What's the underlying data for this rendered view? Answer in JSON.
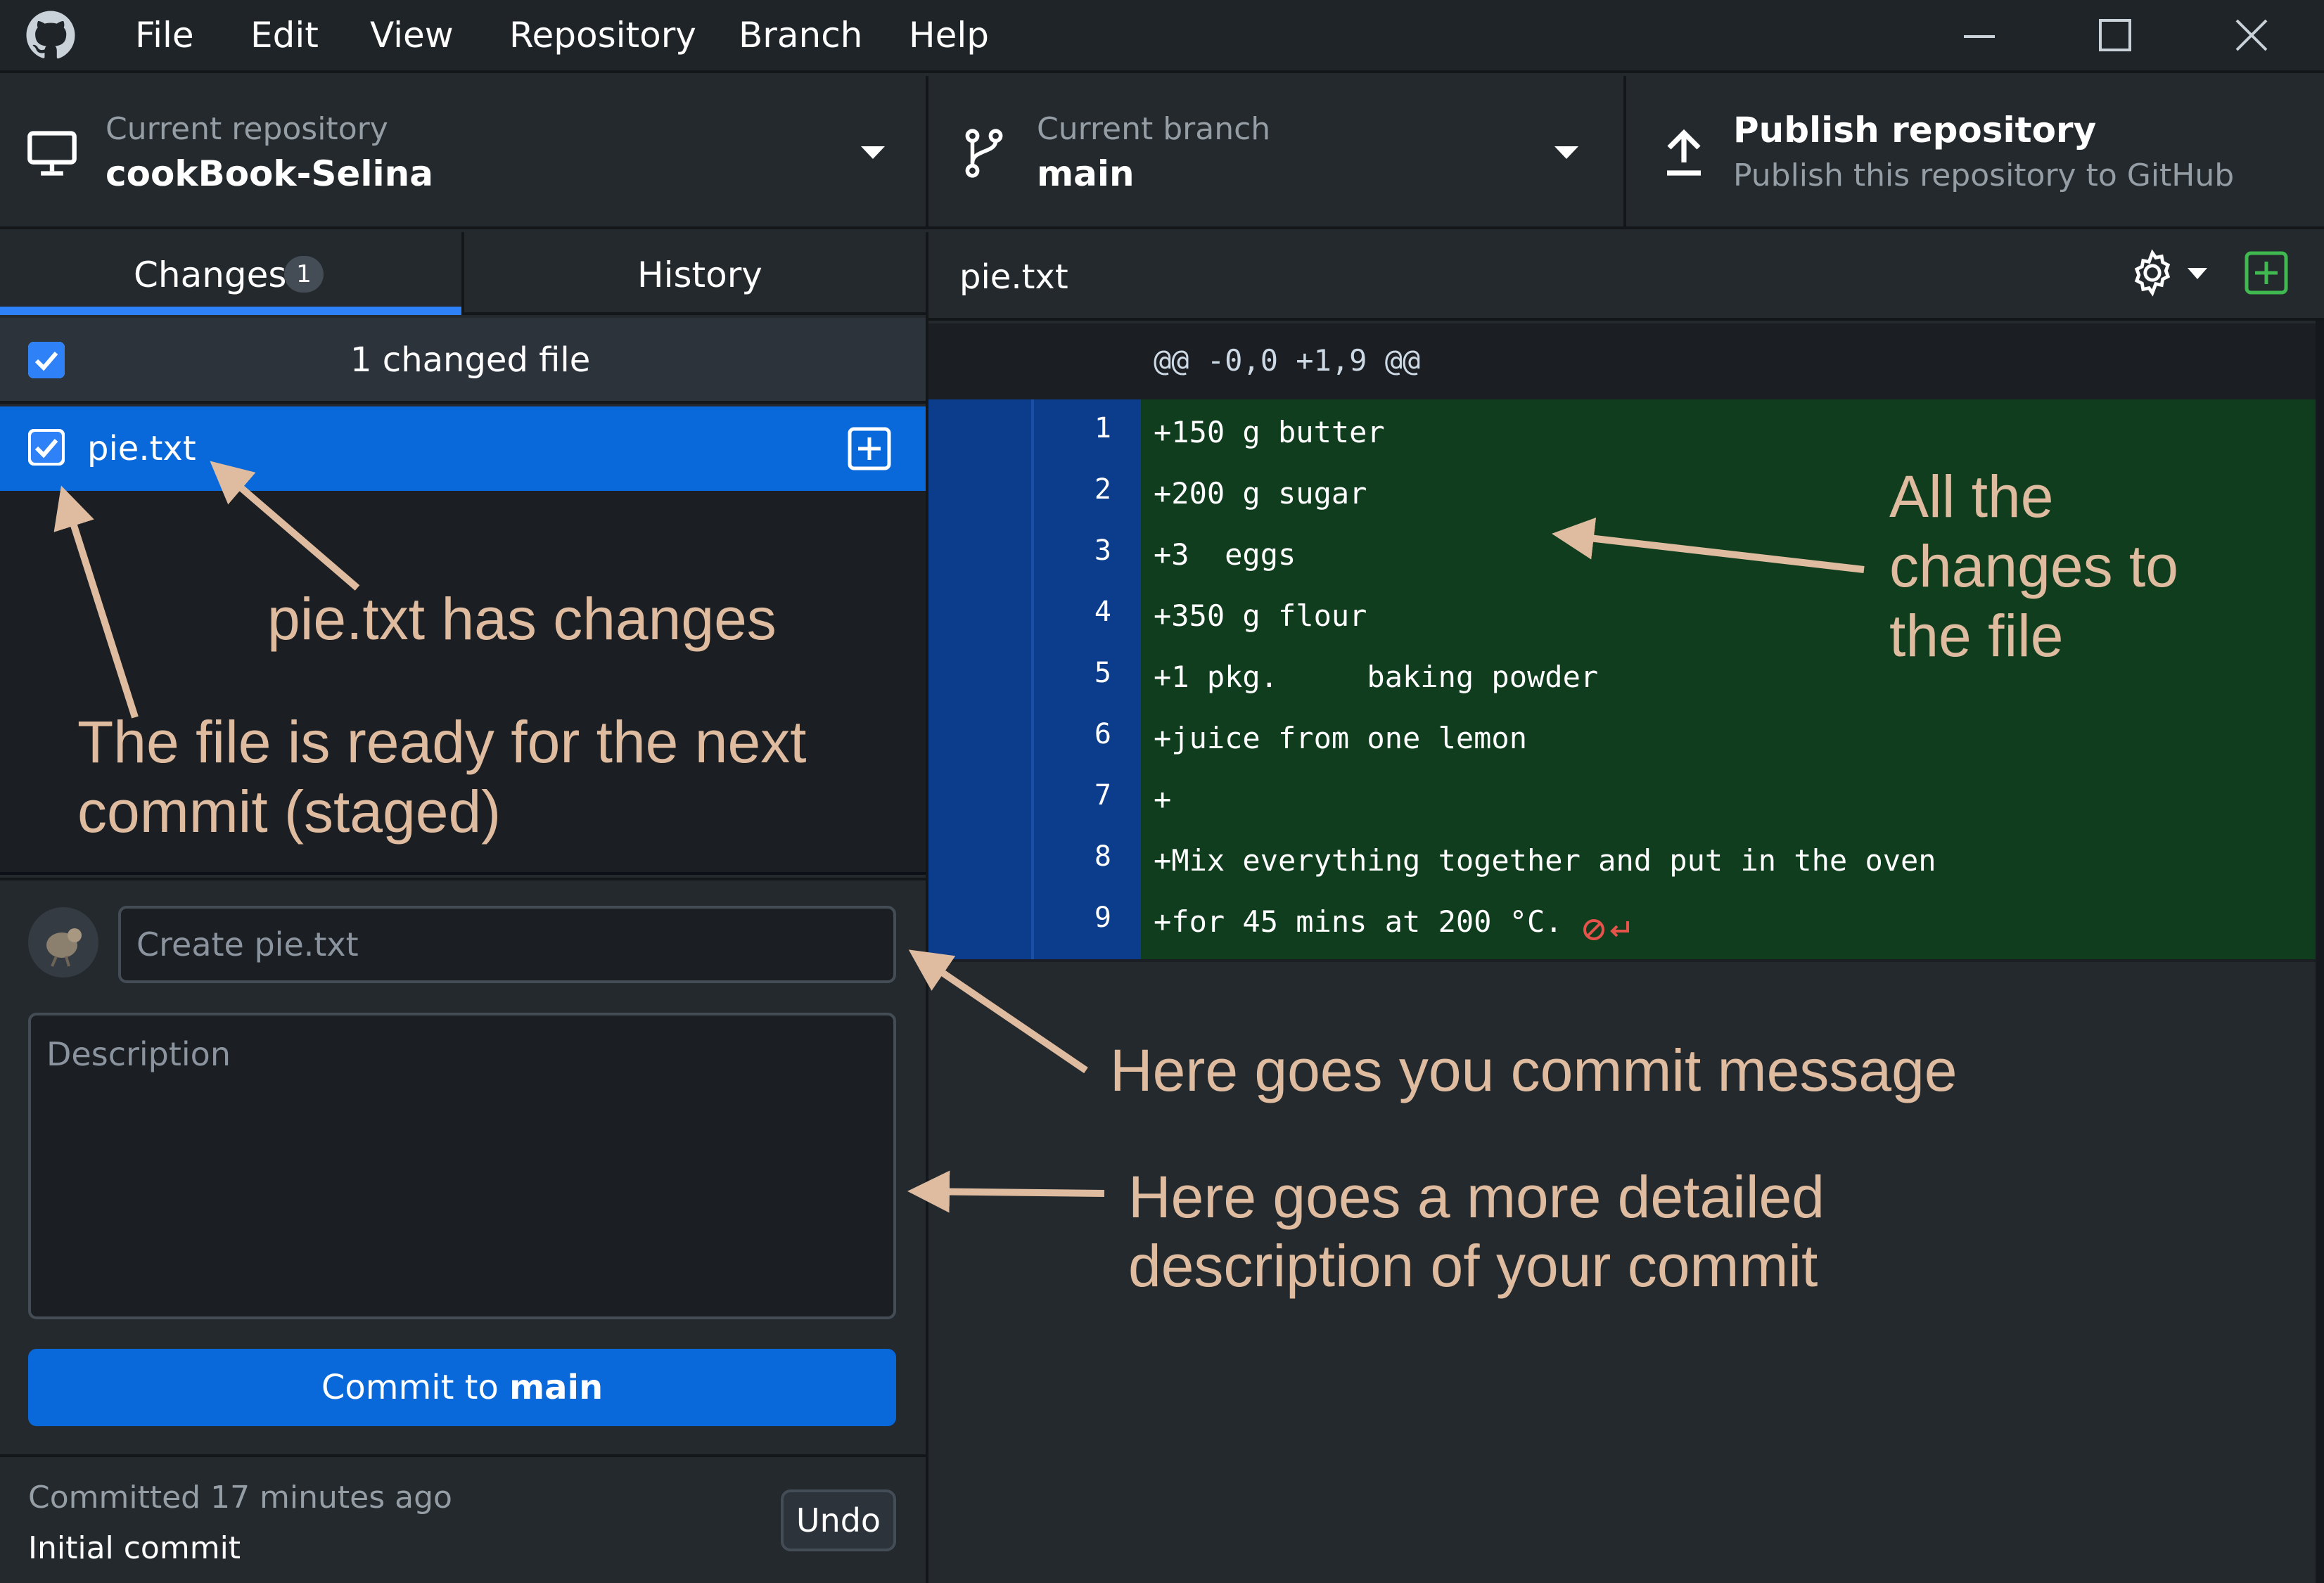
{
  "menu": [
    "File",
    "Edit",
    "View",
    "Repository",
    "Branch",
    "Help"
  ],
  "toolbar": {
    "repo_caption": "Current repository",
    "repo_name": "cookBook-Selina",
    "branch_caption": "Current branch",
    "branch_name": "main",
    "publish_title": "Publish repository",
    "publish_subtitle": "Publish this repository to GitHub"
  },
  "tabs": {
    "changes_label": "Changes",
    "changes_count": "1",
    "history_label": "History"
  },
  "changes": {
    "header": "1 changed file",
    "files": [
      {
        "name": "pie.txt",
        "checked": true
      }
    ]
  },
  "commit": {
    "summary_placeholder": "Create pie.txt",
    "description_placeholder": "Description",
    "button_prefix": "Commit to",
    "button_branch": "main"
  },
  "last_commit": {
    "time": "Committed 17 minutes ago",
    "message": "Initial commit",
    "undo_label": "Undo"
  },
  "diff": {
    "file_name": "pie.txt",
    "hunk_header": "@@ -0,0 +1,9 @@",
    "lines": [
      {
        "num": "1",
        "text": "+150 g butter"
      },
      {
        "num": "2",
        "text": "+200 g sugar"
      },
      {
        "num": "3",
        "text": "+3  eggs"
      },
      {
        "num": "4",
        "text": "+350 g flour"
      },
      {
        "num": "5",
        "text": "+1 pkg.     baking powder"
      },
      {
        "num": "6",
        "text": "+juice from one lemon"
      },
      {
        "num": "7",
        "text": "+"
      },
      {
        "num": "8",
        "text": "+Mix everything together and put in the oven"
      },
      {
        "num": "9",
        "text": "+for 45 mins at 200 °C."
      }
    ]
  },
  "annotations": {
    "pie_changes": "pie.txt has changes",
    "staged_line1": "The file is ready for the next",
    "staged_line2": "commit (staged)",
    "all_changes_line1": "All the",
    "all_changes_line2": "changes to",
    "all_changes_line3": "the file",
    "commit_message": "Here goes you commit message",
    "description_line1": "Here goes a more detailed",
    "description_line2": "description of your commit"
  },
  "colors": {
    "accent": "#0969da",
    "addition_bg": "#113d1f",
    "gutter_bg": "#0c3c8c",
    "annotation": "#dfbc9f",
    "no_newline_icon": "#e5534b"
  }
}
